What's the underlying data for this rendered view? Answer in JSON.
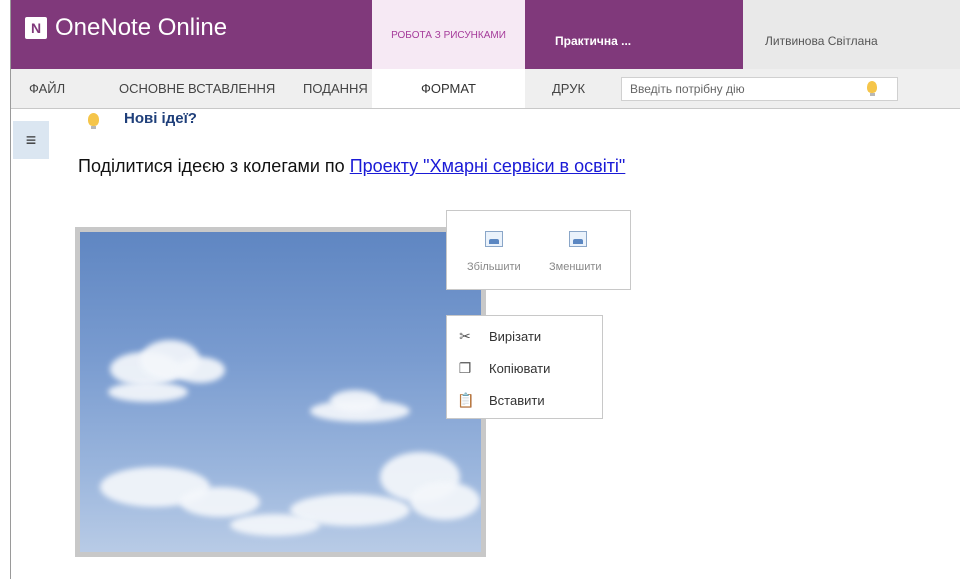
{
  "app": {
    "name": "OneNote Online",
    "logo_letter": "N",
    "context_tab": "РОБОТА З РИСУНКАМИ",
    "document_title": "Практична ...",
    "user_name": "Литвинова Світлана",
    "brand_color": "#80397b"
  },
  "ribbon": {
    "tabs": [
      "ФАЙЛ",
      "ОСНОВНЕ",
      "ВСТАВЛЕННЯ",
      "ПОДАННЯ",
      "ФОРМАТ",
      "ДРУК"
    ],
    "active_tab": "ФОРМАТ",
    "search_placeholder": "Введіть потрібну дію"
  },
  "page": {
    "idea_title": "Нові ідеї?",
    "share_text": "Поділитися ідеєю з колегами по ",
    "share_link": "Проекту \"Хмарні сервіси в освіті\""
  },
  "size_box": {
    "enlarge_label": "Збільшити",
    "shrink_label": "Зменшити"
  },
  "context_menu": {
    "items": [
      {
        "label": "Вирізати",
        "icon": "scissors-icon"
      },
      {
        "label": "Копіювати",
        "icon": "copy-icon"
      },
      {
        "label": "Вставити",
        "icon": "paste-icon"
      }
    ]
  }
}
